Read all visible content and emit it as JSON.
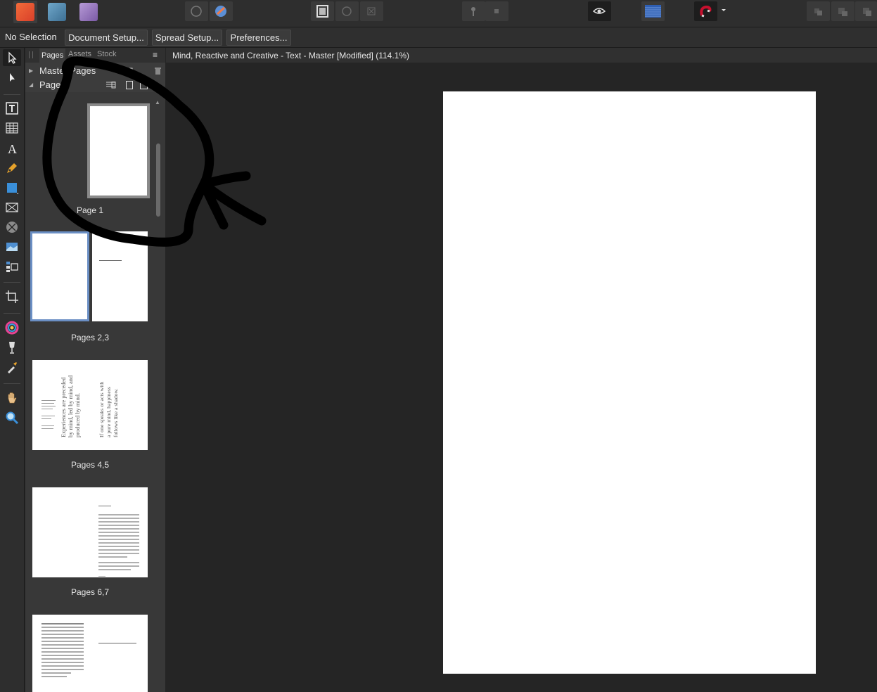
{
  "context_bar": {
    "selection_status": "No Selection",
    "buttons": [
      "Document Setup...",
      "Spread Setup...",
      "Preferences..."
    ]
  },
  "pages_panel": {
    "tabs": [
      "Pages",
      "Assets",
      "Stock"
    ],
    "active_tab": "Pages",
    "sections": {
      "master_pages": "Master Pages",
      "pages": "Pages"
    },
    "thumbnails": [
      {
        "label": "Page 1"
      },
      {
        "label": "Pages 2,3"
      },
      {
        "label": "Pages 4,5",
        "quote_left": "Experiences are preceded by mind, led by mind, and produced by mind.",
        "quote_right": "If one speaks or acts with a pure mind, happiness follows like a shadow."
      },
      {
        "label": "Pages 6,7"
      },
      {
        "label": ""
      }
    ]
  },
  "document": {
    "title": "Mind, Reactive and Creative - Text - Master [Modified] (114.1%)"
  },
  "icons": {
    "apps": [
      "affinity-publisher-icon",
      "affinity-designer-icon",
      "affinity-photo-icon"
    ],
    "tools": [
      "move-tool-icon",
      "node-tool-icon",
      "frame-text-tool-icon",
      "table-tool-icon",
      "artistic-text-tool-icon",
      "pen-tool-icon",
      "rectangle-tool-icon",
      "picture-frame-icon",
      "ellipse-frame-icon",
      "place-image-icon",
      "data-merge-icon",
      "crop-tool-icon",
      "color-picker-icon",
      "fill-tool-icon",
      "eyedropper-icon",
      "hand-tool-icon",
      "zoom-tool-icon"
    ]
  },
  "colors": {
    "annotation": "#000000",
    "selection_outline": "#6b8fc4",
    "snapping": "#c8102e"
  }
}
